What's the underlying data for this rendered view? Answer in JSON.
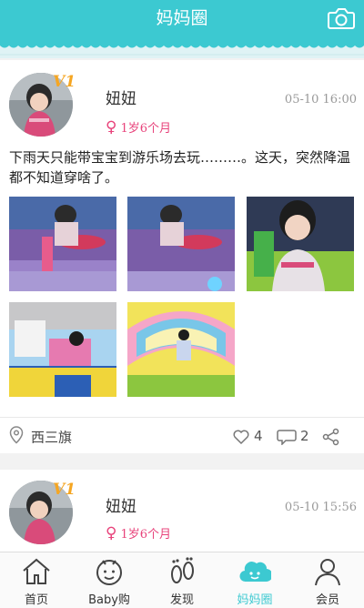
{
  "header": {
    "title": "妈妈圈",
    "camera_icon": "camera-icon"
  },
  "posts": [
    {
      "user_name": "妞妞",
      "level_badge": "V1",
      "time": "05-10 16:00",
      "age": "1岁6个月",
      "gender_icon": "female-icon",
      "content": "下雨天只能带宝宝到游乐场去玩………。这天，突然降温都不知道穿啥了。",
      "photo_count": 5,
      "location": "西三旗",
      "likes": "4",
      "comments": "2"
    },
    {
      "user_name": "妞妞",
      "level_badge": "V1",
      "time": "05-10 15:56",
      "age": "1岁6个月",
      "gender_icon": "female-icon"
    }
  ],
  "tabbar": {
    "active": "妈妈圈",
    "items": [
      {
        "label": "首页",
        "icon": "home-icon"
      },
      {
        "label": "Baby购",
        "icon": "baby-face-icon"
      },
      {
        "label": "发现",
        "icon": "footprints-icon"
      },
      {
        "label": "妈妈圈",
        "icon": "cloud-icon"
      },
      {
        "label": "会员",
        "icon": "person-icon"
      }
    ]
  },
  "colors": {
    "accent": "#3cc9d1",
    "age_pink": "#e8437b",
    "badge_orange": "#f5a623"
  }
}
